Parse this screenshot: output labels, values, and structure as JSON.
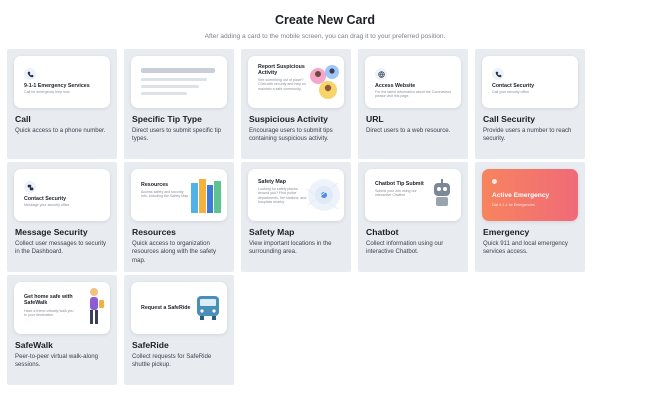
{
  "header": {
    "title": "Create New Card",
    "subtitle": "After adding a card to the mobile screen, you can drag it to your preferred position."
  },
  "cards": [
    {
      "title": "Call",
      "desc": "Quick access to a phone number.",
      "preview": {
        "heading": "9-1-1 Emergency Services",
        "sub": "Call for emergency help now"
      }
    },
    {
      "title": "Specific Tip Type",
      "desc": "Direct users to submit specific tip types.",
      "preview": {}
    },
    {
      "title": "Suspicious Activity",
      "desc": "Encourage users to submit tips containing suspicious activity.",
      "preview": {
        "heading": "Report Suspicious Activity",
        "sub": "See something out of place? Chat with security and help us maintain a safe community."
      }
    },
    {
      "title": "URL",
      "desc": "Direct users to a web resource.",
      "preview": {
        "heading": "Access Website",
        "sub": "For the latest information about the Coronavirus please visit this page."
      }
    },
    {
      "title": "Call Security",
      "desc": "Provide users a number to reach security.",
      "preview": {
        "heading": "Contact Security",
        "sub": "Call your security office"
      }
    },
    {
      "title": "Message Security",
      "desc": "Collect user messages to security in the Dashboard.",
      "preview": {
        "heading": "Contact Security",
        "sub": "Message your security office"
      }
    },
    {
      "title": "Resources",
      "desc": "Quick access to organization resources along with the safety map.",
      "preview": {
        "heading": "Resources",
        "sub": "Access safety and security info, including the Safety Map"
      }
    },
    {
      "title": "Safety Map",
      "desc": "View important locations in the surrounding area.",
      "preview": {
        "heading": "Safety Map",
        "sub": "Looking for safety places around you? Find police departments, fire stations, and hospitals nearby."
      }
    },
    {
      "title": "Chatbot",
      "desc": "Collect information using our interactive Chatbot.",
      "preview": {
        "heading": "Chatbot Tip Submit",
        "sub": "Submit your info using our interactive Chatbot"
      }
    },
    {
      "title": "Emergency",
      "desc": "Quick 911 and local emergency services access.",
      "preview": {
        "heading": "Active Emergency",
        "sub": "Dial 9-1-1 for Emergencies"
      }
    },
    {
      "title": "SafeWalk",
      "desc": "Peer-to-peer virtual walk-along sessions.",
      "preview": {
        "heading": "Get home safe with SafeWalk",
        "sub": "Have a friend virtually walk you to your destination"
      }
    },
    {
      "title": "SafeRide",
      "desc": "Collect requests for SafeRide shuttle pickup.",
      "preview": {
        "heading": "Request a SafeRide",
        "sub": ""
      }
    }
  ],
  "colors": {
    "tile_bg": "#e8ebf0",
    "emergency_start": "#f7845e",
    "emergency_end": "#f06a78"
  },
  "icons": [
    "phone-icon",
    "shield-icon",
    "globe-icon",
    "chat-icon",
    "map-pin-icon",
    "robot-icon",
    "person-walking-icon",
    "bus-icon",
    "books-icon"
  ]
}
